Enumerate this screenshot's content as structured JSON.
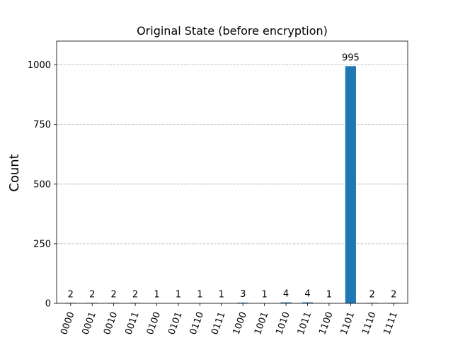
{
  "chart_data": {
    "type": "bar",
    "title": "Original State (before encryption)",
    "xlabel": "",
    "ylabel": "Count",
    "categories": [
      "0000",
      "0001",
      "0010",
      "0011",
      "0100",
      "0101",
      "0110",
      "0111",
      "1000",
      "1001",
      "1010",
      "1011",
      "1100",
      "1101",
      "1110",
      "1111"
    ],
    "values": [
      2,
      2,
      2,
      2,
      1,
      1,
      1,
      1,
      3,
      1,
      4,
      4,
      1,
      995,
      2,
      2
    ],
    "ylim": [
      0,
      1100
    ],
    "yticks": [
      0,
      250,
      500,
      750,
      1000
    ],
    "grid": true,
    "bar_color": "#1f77b4",
    "show_data_labels": true
  }
}
